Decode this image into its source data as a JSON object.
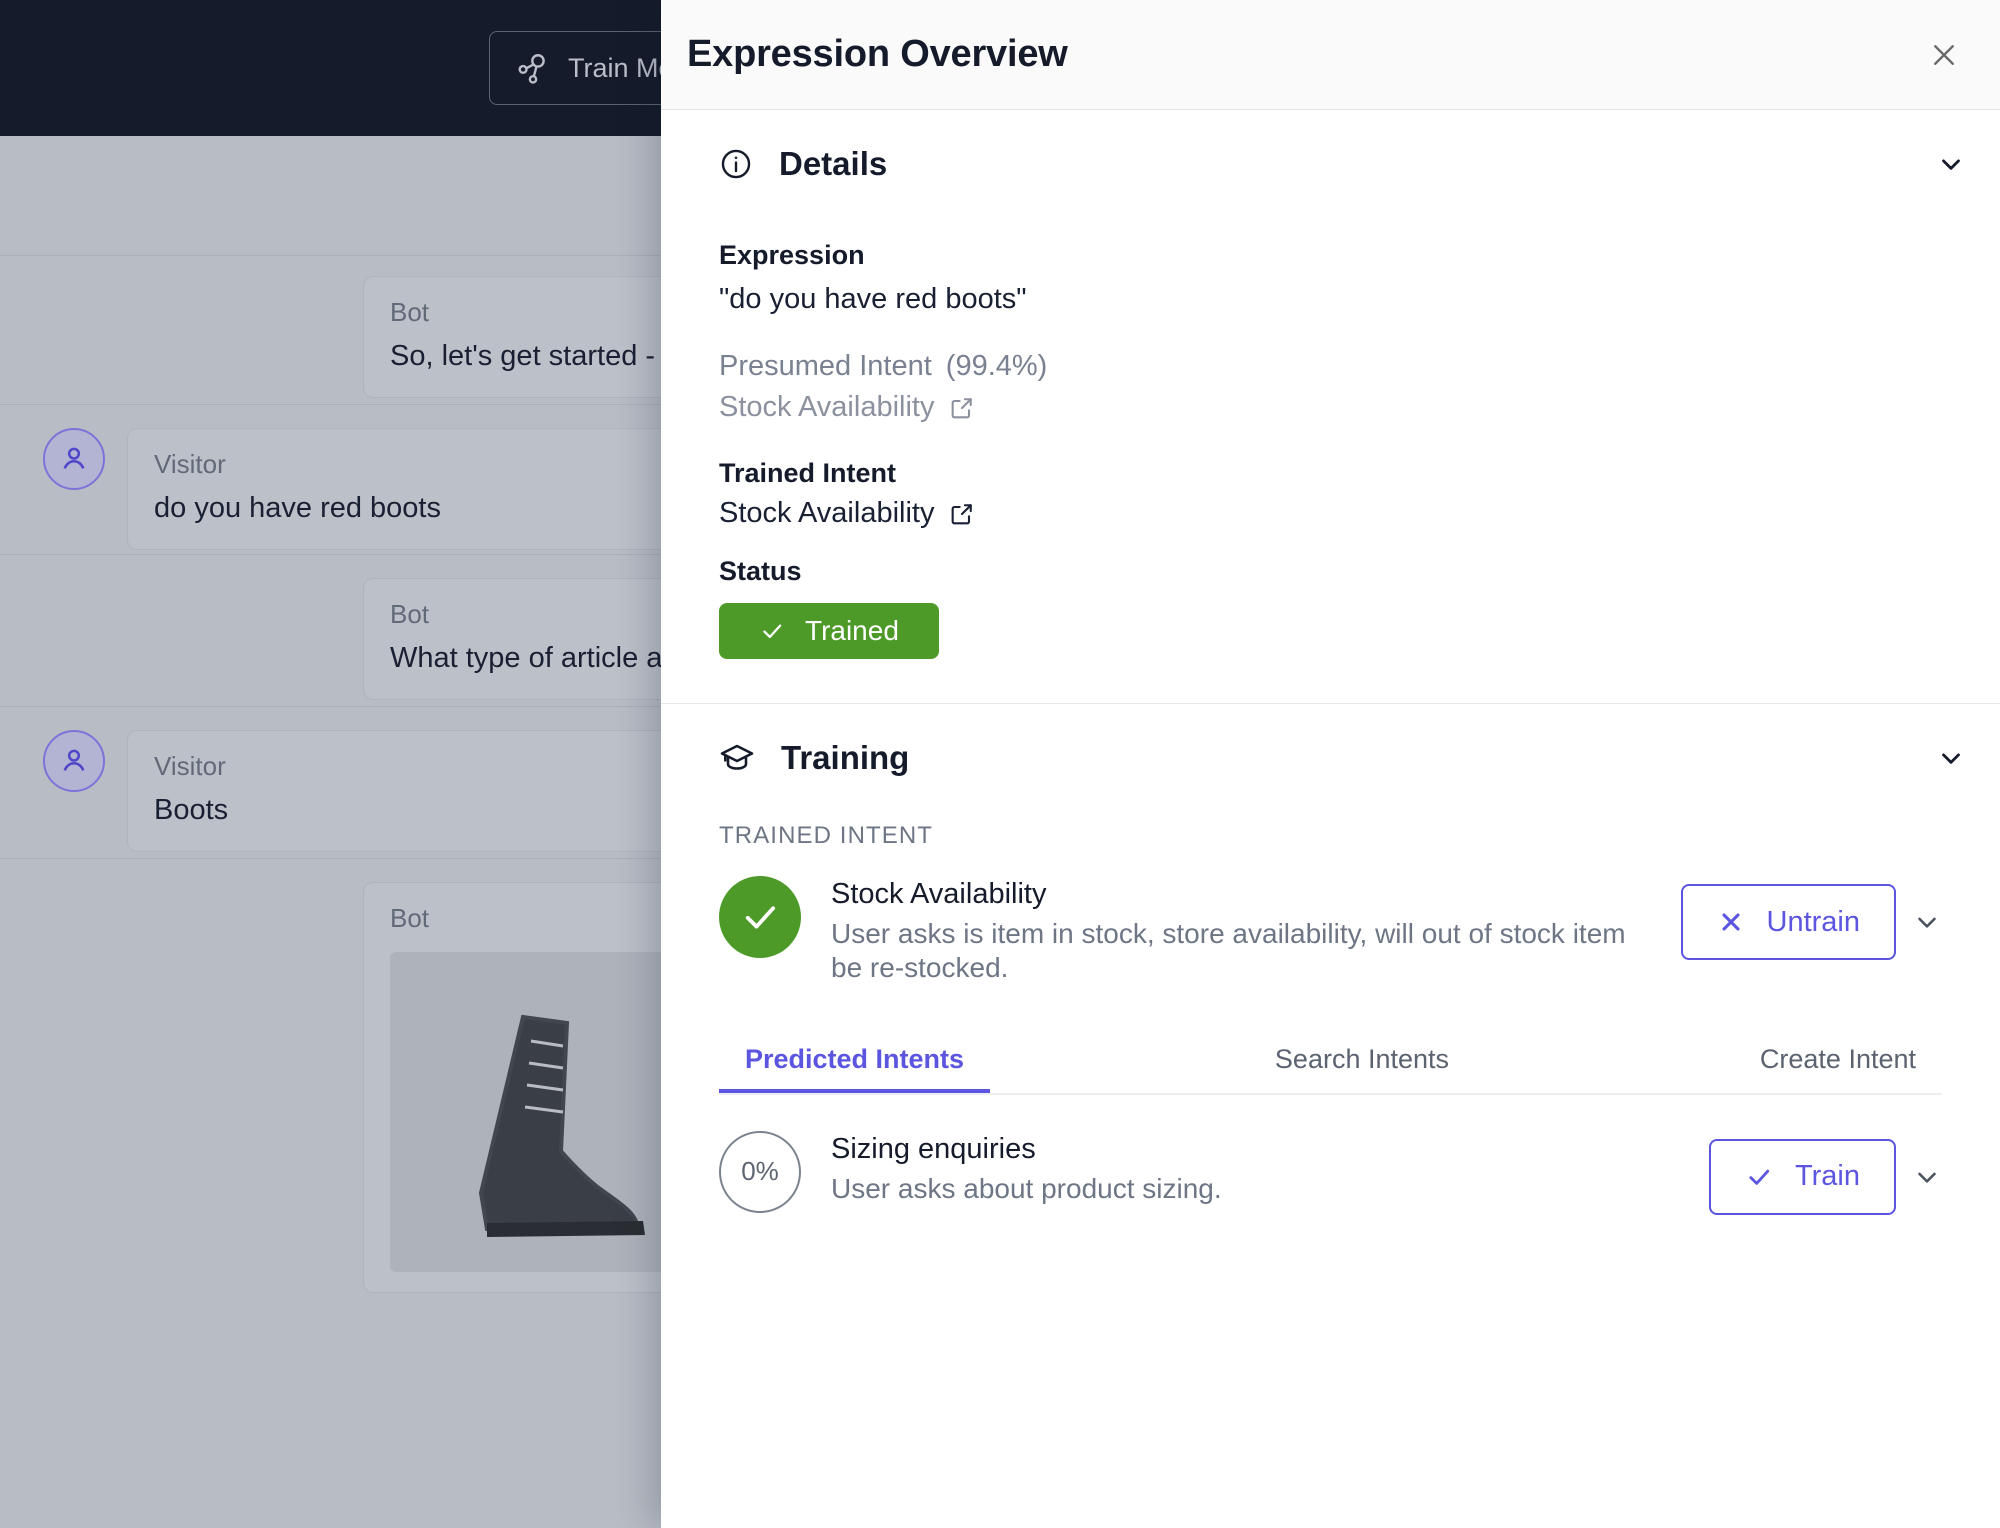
{
  "background_app": {
    "topbar": {
      "train_model_button": "Train Model",
      "train_model_icon": "network-nodes-icon"
    },
    "chat": [
      {
        "role": "Bot",
        "text": "So, let's get started - ask me a question",
        "has_avatar": false
      },
      {
        "role": "Visitor",
        "text": "do you have red boots",
        "has_avatar": true
      },
      {
        "role": "Bot",
        "text": "What type of article are you looking for?",
        "has_avatar": false
      },
      {
        "role": "Visitor",
        "text": "Boots",
        "has_avatar": true
      },
      {
        "role": "Bot",
        "text": "",
        "has_avatar": false,
        "has_image": true
      }
    ]
  },
  "panel": {
    "title": "Expression Overview",
    "close_icon": "close-icon",
    "details": {
      "icon": "info-circle-icon",
      "heading": "Details",
      "collapse_icon": "chevron-down-icon",
      "expression_label": "Expression",
      "expression_value": "\"do you have red boots\"",
      "presumed_intent_label": "Presumed Intent",
      "presumed_intent_confidence": "(99.4%)",
      "presumed_intent_value": "Stock Availability",
      "presumed_intent_link_icon": "external-link-icon",
      "trained_intent_label": "Trained Intent",
      "trained_intent_value": "Stock Availability",
      "trained_intent_link_icon": "external-link-icon",
      "status_label": "Status",
      "status_badge": "Trained",
      "status_badge_icon": "check-icon",
      "status_color": "#4d9a29"
    },
    "training": {
      "icon": "graduation-cap-icon",
      "heading": "Training",
      "collapse_icon": "chevron-down-icon",
      "trained_intent_caption": "TRAINED INTENT",
      "trained_intent": {
        "mark_icon": "check-icon",
        "name": "Stock Availability",
        "description": "User asks is item in stock, store availability, will out of stock item be re-stocked.",
        "action_label": "Untrain",
        "action_icon": "x-icon",
        "action_caret_icon": "chevron-down-icon"
      },
      "tabs": [
        {
          "label": "Predicted Intents",
          "active": true
        },
        {
          "label": "Search Intents",
          "active": false
        },
        {
          "label": "Create Intent",
          "active": false
        }
      ],
      "predicted_intents": [
        {
          "percent": "0%",
          "name": "Sizing enquiries",
          "description": "User asks about product sizing.",
          "action_label": "Train",
          "action_icon": "check-icon",
          "action_caret_icon": "chevron-down-icon"
        }
      ],
      "accent_color": "#5b55e0"
    }
  }
}
